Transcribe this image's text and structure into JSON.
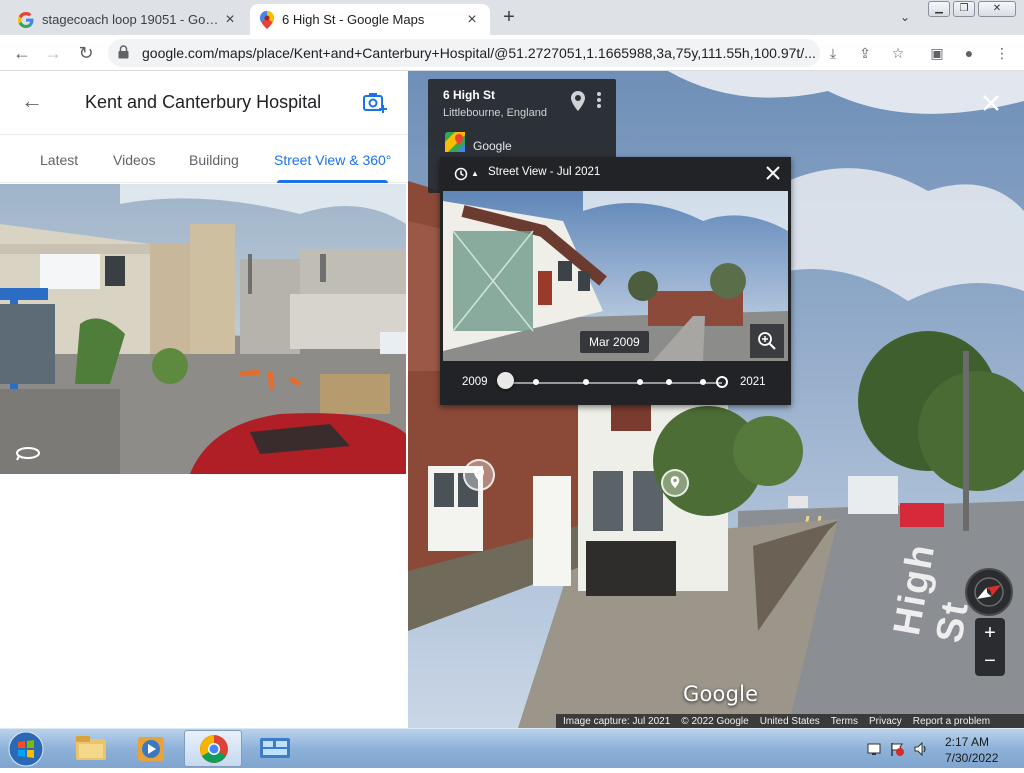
{
  "browser": {
    "tabs": [
      {
        "title": "stagecoach loop 19051 - Google"
      },
      {
        "title": "6 High St - Google Maps"
      }
    ],
    "url": "google.com/maps/place/Kent+and+Canterbury+Hospital/@51.2727051,1.1665988,3a,75y,111.55h,100.97t/..."
  },
  "left_panel": {
    "title": "Kent and Canterbury Hospital",
    "tabs": [
      {
        "label": "Latest"
      },
      {
        "label": "Videos"
      },
      {
        "label": "Building"
      },
      {
        "label": "Street View & 360°"
      }
    ],
    "active_tab": "Street View & 360°"
  },
  "street_view": {
    "place_title": "6 High St",
    "place_subtitle": "Littlebourne, England",
    "place_source": "Google",
    "time_machine": {
      "header": "Street View - Jul 2021",
      "date_label": "Mar 2009",
      "year_start": "2009",
      "year_end": "2021"
    },
    "wordmark": "Google",
    "street_sign": "High St",
    "attribution": {
      "capture": "Image capture: Jul 2021",
      "copyright": "© 2022 Google",
      "region": "United States",
      "terms": "Terms",
      "privacy": "Privacy",
      "report": "Report a problem"
    },
    "zoom_in": "+",
    "zoom_out": "−"
  },
  "taskbar": {
    "time": "2:17 AM",
    "date": "7/30/2022"
  }
}
